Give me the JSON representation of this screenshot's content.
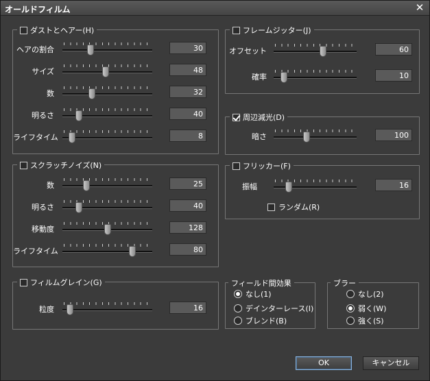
{
  "title": "オールドフィルム",
  "dust": {
    "label": "ダストとヘアー(H)",
    "checked": false,
    "rows": [
      {
        "label": "ヘアの割合",
        "value": "30",
        "pos": 0.3
      },
      {
        "label": "サイズ",
        "value": "48",
        "pos": 0.48
      },
      {
        "label": "数",
        "value": "32",
        "pos": 0.32
      },
      {
        "label": "明るさ",
        "value": "40",
        "pos": 0.16
      },
      {
        "label": "ライフタイム",
        "value": "8",
        "pos": 0.08
      }
    ]
  },
  "scratch": {
    "label": "スクラッチノイズ(N)",
    "checked": false,
    "rows": [
      {
        "label": "数",
        "value": "25",
        "pos": 0.25
      },
      {
        "label": "明るさ",
        "value": "40",
        "pos": 0.16
      },
      {
        "label": "移動度",
        "value": "128",
        "pos": 0.5
      },
      {
        "label": "ライフタイム",
        "value": "80",
        "pos": 0.8
      }
    ]
  },
  "grain": {
    "label": "フィルムグレイン(G)",
    "checked": false,
    "rows": [
      {
        "label": "粒度",
        "value": "16",
        "pos": 0.06
      }
    ]
  },
  "jitter": {
    "label": "フレームジッター(J)",
    "checked": false,
    "rows": [
      {
        "label": "オフセット",
        "value": "60",
        "pos": 0.6
      },
      {
        "label": "確率",
        "value": "10",
        "pos": 0.1
      }
    ]
  },
  "vignette": {
    "label": "周辺減光(D)",
    "checked": true,
    "rows": [
      {
        "label": "暗さ",
        "value": "100",
        "pos": 0.39
      }
    ]
  },
  "flicker": {
    "label": "フリッカー(F)",
    "checked": false,
    "rows": [
      {
        "label": "振幅",
        "value": "16",
        "pos": 0.16
      }
    ],
    "random_label": "ランダム(R)",
    "random_checked": false
  },
  "field": {
    "label": "フィールド間効果",
    "options": [
      "なし(1)",
      "デインターレース(I)",
      "ブレンド(B)"
    ],
    "selected": 0
  },
  "blur": {
    "label": "ブラー",
    "options": [
      "なし(2)",
      "弱く(W)",
      "強く(S)"
    ],
    "selected": 1
  },
  "buttons": {
    "ok": "OK",
    "cancel": "キャンセル"
  }
}
